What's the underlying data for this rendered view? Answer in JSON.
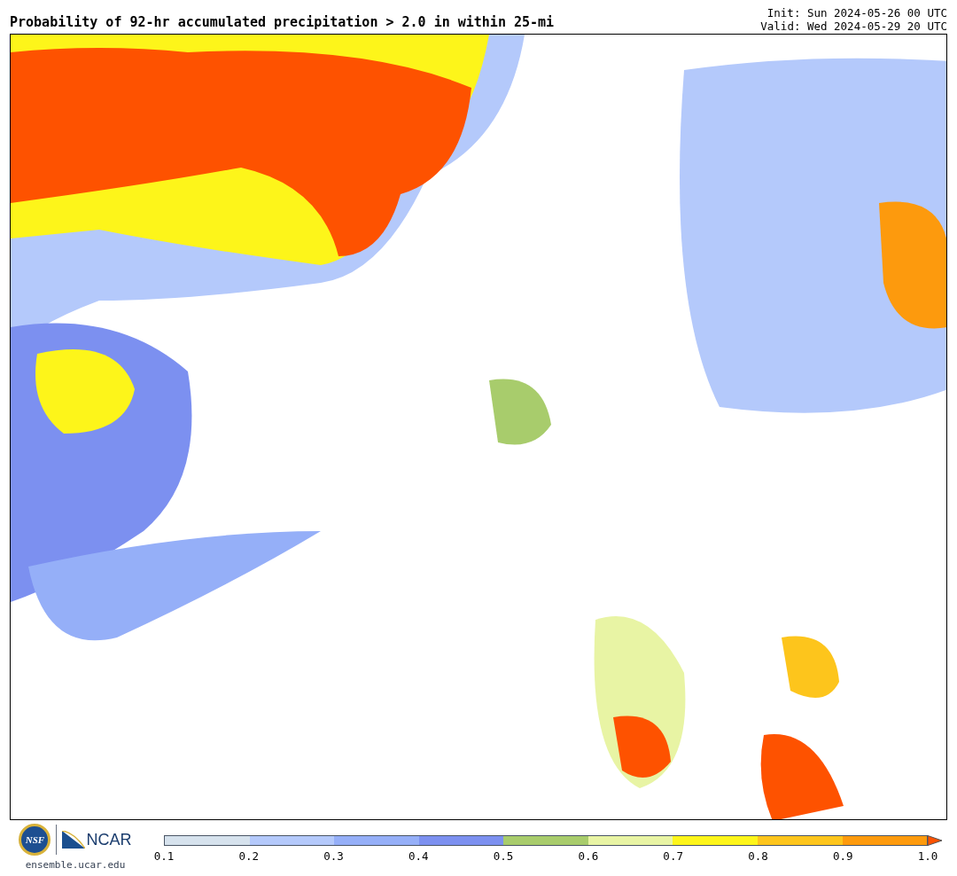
{
  "title": "Probability of 92-hr accumulated precipitation > 2.0 in within 25-mi",
  "init": "Init: Sun 2024-05-26 00 UTC",
  "valid": "Valid: Wed 2024-05-29 20 UTC",
  "logos": {
    "nsf": "NSF",
    "ncar": "NCAR",
    "site": "ensemble.ucar.edu"
  },
  "colorbar": {
    "segments": [
      {
        "color": "#d6e2ed"
      },
      {
        "color": "#b4c9fb"
      },
      {
        "color": "#95aff8"
      },
      {
        "color": "#7c90f0"
      },
      {
        "color": "#a8cc6c"
      },
      {
        "color": "#e8f4a4"
      },
      {
        "color": "#fdf51a"
      },
      {
        "color": "#fdc51c"
      },
      {
        "color": "#fd9a0d"
      },
      {
        "kind": "extension",
        "color": "#fe5200"
      }
    ],
    "ticks": [
      "0.1",
      "0.2",
      "0.3",
      "0.4",
      "0.5",
      "0.6",
      "0.7",
      "0.8",
      "0.9",
      "1.0"
    ]
  }
}
